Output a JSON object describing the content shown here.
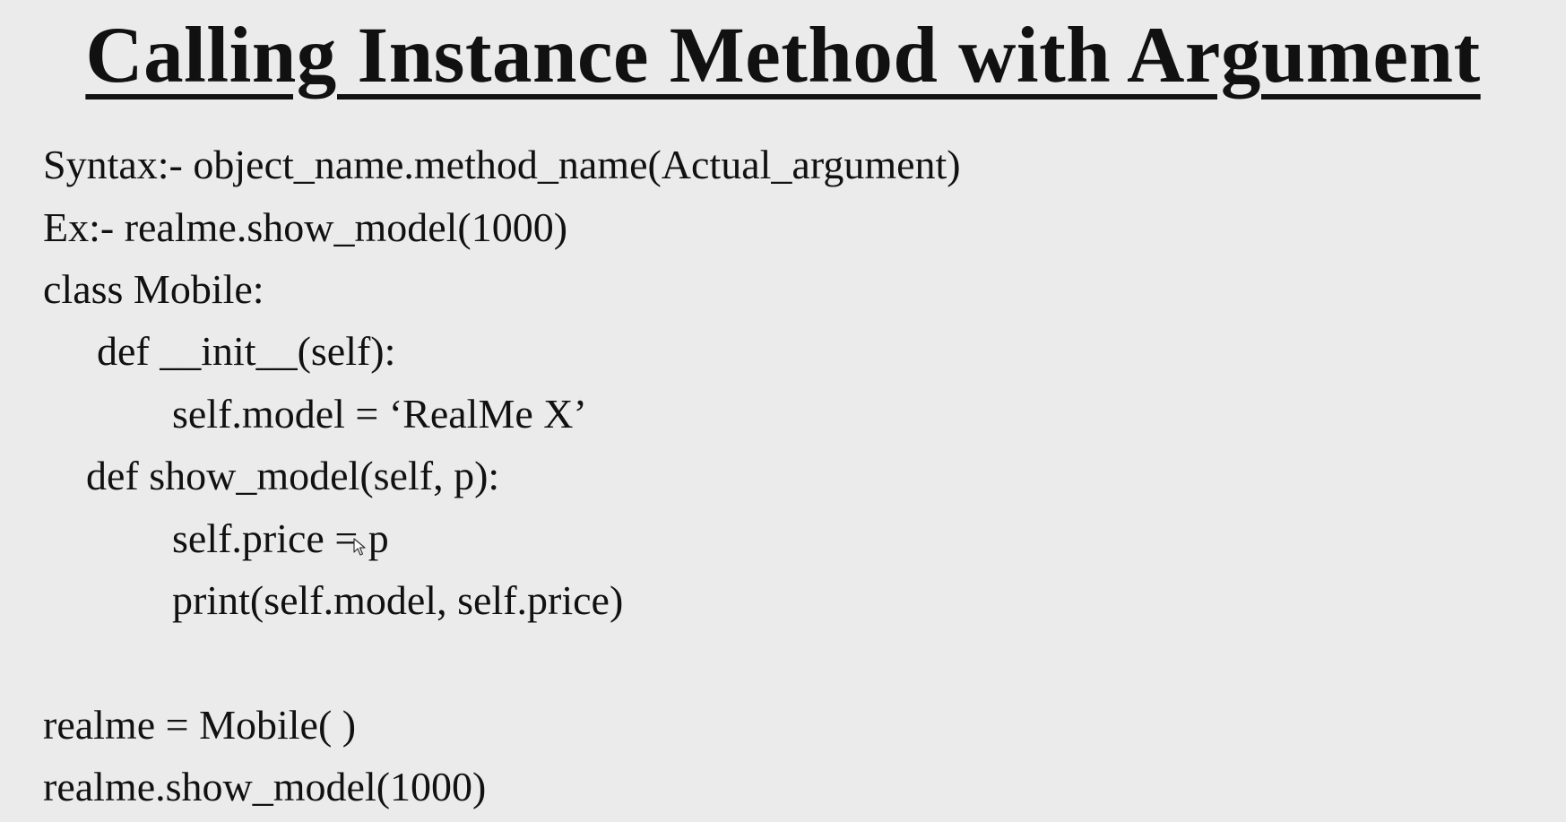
{
  "slide": {
    "title": "Calling Instance Method with Argument",
    "lines": [
      "Syntax:- object_name.method_name(Actual_argument)",
      "Ex:- realme.show_model(1000)",
      "class Mobile:",
      "def __init__(self):",
      "self.model = ‘RealMe X’",
      "def show_model(self, p):",
      "self.price = p",
      "print(self.model, self.price)",
      "realme = Mobile( )",
      "realme.show_model(1000)"
    ]
  },
  "cursor_icon": "mouse-pointer-icon"
}
